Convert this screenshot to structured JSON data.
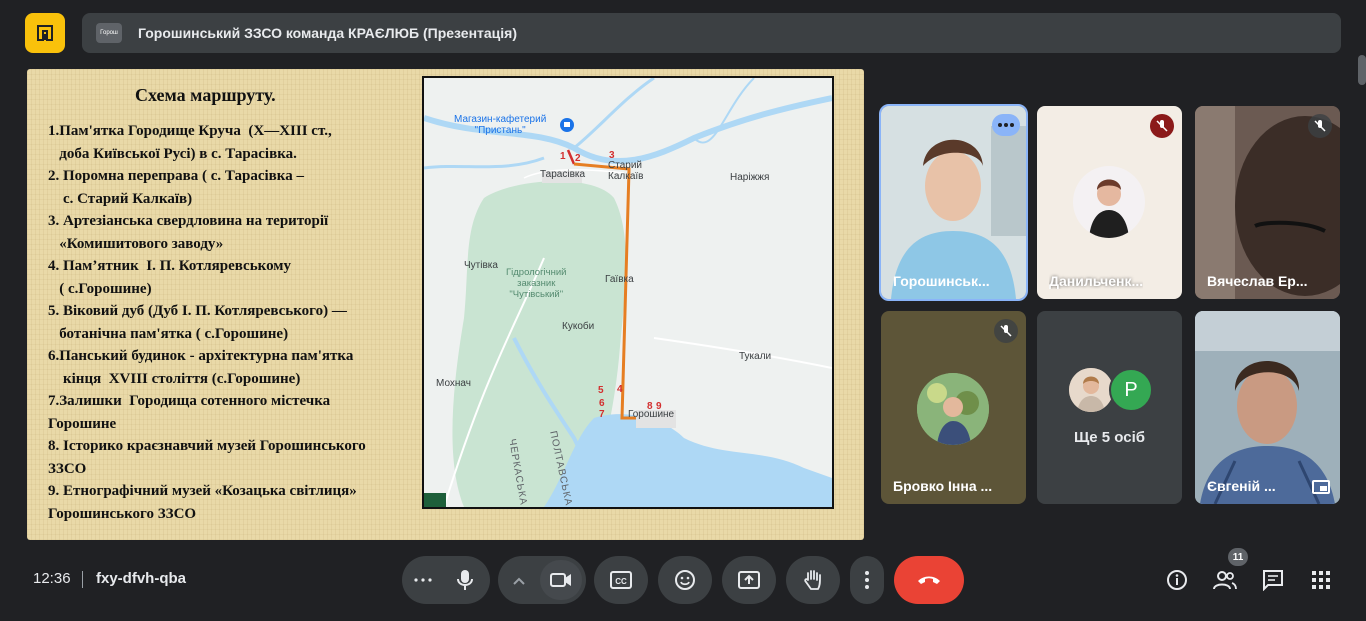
{
  "presentation": {
    "title": "Горошинський ЗЗСО команда КРАЄЛЮБ (Презентація)",
    "avatar_text": "Горош"
  },
  "slide": {
    "title": "Схема маршруту.",
    "items": [
      "1.Пам'ятка Городище Круча  (X—XIII ст.,\n   доба Київської Русі) в с. Тарасівка.",
      "2. Поромна переправа ( с. Тарасівка –\n    с. Старий Калкаїв)",
      "3. Артезіанська свердловина на території\n   «Комишитового заводу»",
      "4. Пам’ятник  І. П. Котляревському\n   ( с.Горошине)",
      "5. Віковий дуб (Дуб І. П. Котляревського) —\n   ботанічна пам'ятка ( с.Горошине)",
      "6.Панський будинок - архітектурна пам'ятка\n    кінця  XVIII століття (с.Горошине)",
      "7.Залишки  Городища сотенного містечка\nГорошине",
      "8. Історико краєзнавчий музей Горошинського\nЗЗСО",
      "9. Етнографічний музей «Козацька світлиця»\nГорошинського ЗЗСО"
    ],
    "map": {
      "poi": "Магазин-кафетерий\n\"Пристань\"",
      "reserve": "Гідрологічний\nзаказник\n\"Чутівський\"",
      "places": {
        "tarasivka": "Тарасівка",
        "staryi": "Старий\nКалкаїв",
        "narizhzhia": "Наріжжя",
        "chutivka": "Чутівка",
        "haivka": "Гаївка",
        "kukobi": "Кукоби",
        "tukaly": "Тукали",
        "mokhnach": "Мохнач",
        "horoshyne": "Горошине"
      },
      "roads": {
        "cherkaska": "ЧЕРКАСЬКА О",
        "poltavska": "ПОЛТАВСЬКА О"
      },
      "numbers": [
        "1",
        "2",
        "3",
        "4",
        "5",
        "6",
        "7",
        "8",
        "9"
      ],
      "colors": {
        "route": "#e67e22",
        "route_start": "#d32f2f",
        "water": "#aed8f5",
        "reserve": "#c9e4d2"
      }
    }
  },
  "participants": [
    {
      "name": "Горошинськ...",
      "active": true
    },
    {
      "name": "Данильченк...",
      "muted": true
    },
    {
      "name": "Вячеслав Ер...",
      "muted": true
    },
    {
      "name": "Бровко Інна ...",
      "muted": true
    },
    {
      "more_label": "Ще 5 осіб",
      "avatar_letter": "P"
    },
    {
      "name": "Євгеній ..."
    }
  ],
  "bottom": {
    "time": "12:36",
    "meeting_code": "fxy-dfvh-qba",
    "people_count": "11",
    "icons": {
      "more_options": "more-horiz-icon",
      "mic": "mic-icon",
      "expand": "chevron-up-icon",
      "camera": "videocam-icon",
      "captions": "closed-captions-icon",
      "emoji": "emoji-icon",
      "present": "present-screen-icon",
      "raise_hand": "raise-hand-icon",
      "more_vert": "more-vert-icon",
      "end_call": "call-end-icon",
      "info": "info-icon",
      "people": "people-icon",
      "chat": "chat-icon",
      "activities": "apps-grid-icon"
    }
  }
}
